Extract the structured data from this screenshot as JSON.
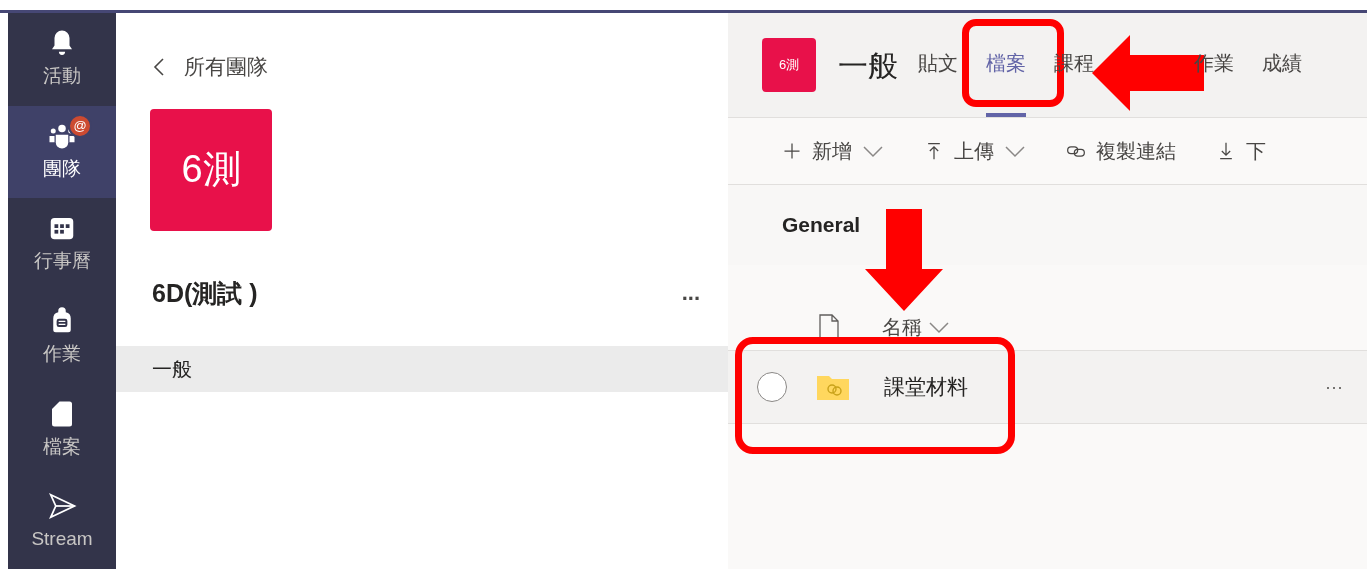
{
  "rail": [
    {
      "label": "活動",
      "kind": "bell",
      "selected": false
    },
    {
      "label": "團隊",
      "kind": "people",
      "selected": true,
      "badge": "@"
    },
    {
      "label": "行事曆",
      "kind": "calendar",
      "selected": false
    },
    {
      "label": "作業",
      "kind": "backpack",
      "selected": false
    },
    {
      "label": "檔案",
      "kind": "file",
      "selected": false
    },
    {
      "label": "Stream",
      "kind": "send",
      "selected": false
    }
  ],
  "team_panel": {
    "back_link": "所有團隊",
    "avatar": "6測",
    "team_name": "6D(測試 )",
    "more": "...",
    "channels": [
      {
        "name": "一般",
        "selected": true
      }
    ]
  },
  "channel": {
    "avatar": "6測",
    "title": "一般",
    "tabs": [
      {
        "label": "貼文",
        "selected": false,
        "highlighted": false
      },
      {
        "label": "檔案",
        "selected": true,
        "highlighted": true
      },
      {
        "label": "課程",
        "selected": false,
        "highlighted": false
      },
      {
        "label": "作業",
        "selected": false,
        "highlighted": false
      },
      {
        "label": "成績",
        "selected": false,
        "highlighted": false
      }
    ]
  },
  "toolbar": [
    {
      "label": "新增",
      "kind": "plus",
      "dropdown": true
    },
    {
      "label": "上傳",
      "kind": "upload",
      "dropdown": true
    },
    {
      "label": "複製連結",
      "kind": "link",
      "dropdown": false
    },
    {
      "label": "下",
      "kind": "download",
      "dropdown": false
    }
  ],
  "files": {
    "folder": "General",
    "columns": [
      {
        "label": "名稱",
        "sorted": true
      }
    ],
    "rows": [
      {
        "name": "課堂材料",
        "checked": false,
        "highlighted": true,
        "more": "···"
      }
    ]
  }
}
